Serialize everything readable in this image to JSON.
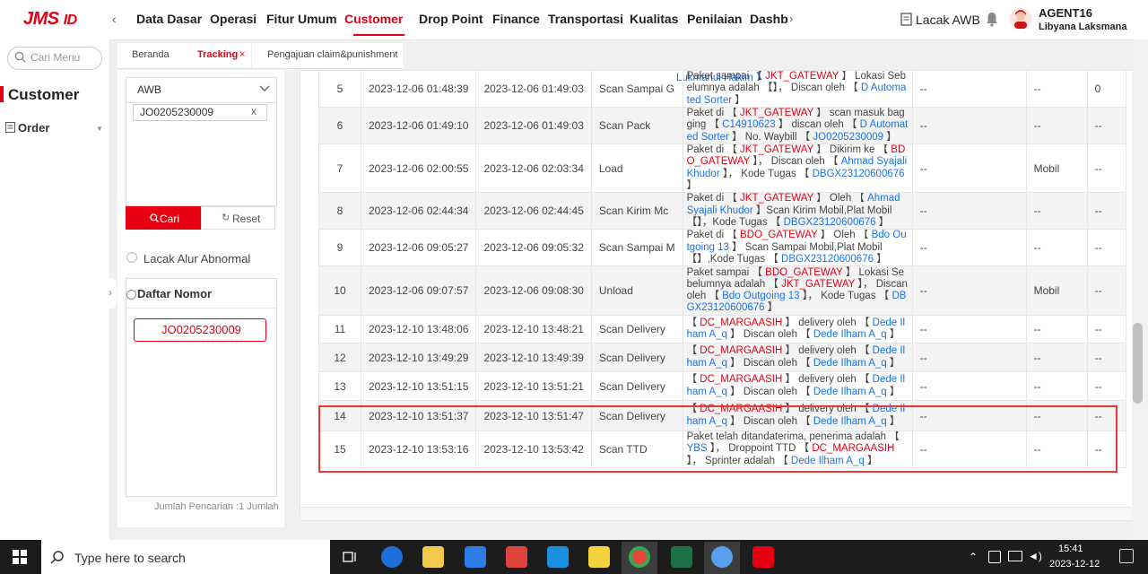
{
  "brand": {
    "logo": "JMS",
    "logo_suffix": "ID"
  },
  "nav": {
    "items": [
      "Data Dasar",
      "Operasi",
      "Fitur Umum",
      "Customer",
      "Drop Point",
      "Finance",
      "Transportasi",
      "Kualitas",
      "Penilaian",
      "Dashb"
    ],
    "active": "Customer",
    "lacak_awb": "Lacak AWB",
    "agent_code": "AGENT16",
    "agent_name": "Libyana Laksmana"
  },
  "sidebar": {
    "search_placeholder": "Cari Menu",
    "section_title": "Customer",
    "order_label": "Order"
  },
  "tabs": [
    {
      "label": "Beranda"
    },
    {
      "label": "Tracking",
      "close": "×"
    },
    {
      "label": "Pengajuan claim&punishment"
    }
  ],
  "filter": {
    "awb_type": "AWB",
    "awb_tag": "JO0205230009",
    "awb_tag_close": "x",
    "search_button": "Cari",
    "reset_button": "Reset",
    "abnormal_label": "Lacak Alur Abnormal",
    "list_title": "Daftar Nomor",
    "list_items": [
      "JO0205230009"
    ],
    "count_text": "Jumlah Pencarian :1  Jumlah"
  },
  "table": {
    "top_partial": "Lukmanul Hakim 】",
    "rows": [
      {
        "no": "5",
        "scan_time": "2023-12-06 01:48:39",
        "upload_time": "2023-12-06 01:49:03",
        "type": "Scan Sampai G",
        "desc": [
          [
            "Paket sampai 【 ",
            ""
          ],
          [
            "JKT_GATEWAY",
            "red"
          ],
          [
            " 】 Lokasi Sebelumnya adalah 【】， Discan oleh 【 ",
            ""
          ],
          [
            "D Automated Sorter",
            "blue"
          ],
          [
            " 】",
            ""
          ]
        ],
        "c6": "--",
        "c7": "--",
        "c8": "0"
      },
      {
        "no": "6",
        "scan_time": "2023-12-06 01:49:10",
        "upload_time": "2023-12-06 01:49:03",
        "type": "Scan Pack",
        "desc": [
          [
            "Paket di 【 ",
            ""
          ],
          [
            "JKT_GATEWAY",
            "red"
          ],
          [
            " 】 scan masuk bagging 【 ",
            ""
          ],
          [
            "C14910623",
            "blue"
          ],
          [
            " 】 discan oleh 【 ",
            ""
          ],
          [
            "D Automated Sorter",
            "blue"
          ],
          [
            " 】 No. Waybill 【 ",
            ""
          ],
          [
            "JO0205230009",
            "blue"
          ],
          [
            " 】",
            ""
          ]
        ],
        "c6": "--",
        "c7": "--",
        "c8": "--"
      },
      {
        "no": "7",
        "scan_time": "2023-12-06 02:00:55",
        "upload_time": "2023-12-06 02:03:34",
        "type": "Load",
        "desc": [
          [
            "Paket di 【 ",
            ""
          ],
          [
            "JKT_GATEWAY",
            "red"
          ],
          [
            " 】 Dikirim ke 【 ",
            ""
          ],
          [
            "BDO_GATEWAY",
            "red"
          ],
          [
            " 】， Discan oleh 【 ",
            ""
          ],
          [
            "Ahmad Syajali Khudor",
            "blue"
          ],
          [
            " 】， Kode Tugas 【 ",
            ""
          ],
          [
            "DBGX23120600676",
            "blue"
          ],
          [
            " 】",
            ""
          ]
        ],
        "c6": "--",
        "c7": "Mobil",
        "c8": "--"
      },
      {
        "no": "8",
        "scan_time": "2023-12-06 02:44:34",
        "upload_time": "2023-12-06 02:44:45",
        "type": "Scan Kirim Mc",
        "desc": [
          [
            "Paket di 【 ",
            ""
          ],
          [
            "JKT_GATEWAY",
            "red"
          ],
          [
            " 】 Oleh 【 ",
            ""
          ],
          [
            "Ahmad Syajali Khudor",
            "blue"
          ],
          [
            " 】Scan Kirim Mobil,Plat Mobil 【】，Kode Tugas 【 ",
            ""
          ],
          [
            "DBGX23120600676",
            "blue"
          ],
          [
            " 】",
            ""
          ]
        ],
        "c6": "--",
        "c7": "--",
        "c8": "--"
      },
      {
        "no": "9",
        "scan_time": "2023-12-06 09:05:27",
        "upload_time": "2023-12-06 09:05:32",
        "type": "Scan Sampai M",
        "desc": [
          [
            "Paket di 【 ",
            ""
          ],
          [
            "BDO_GATEWAY",
            "red"
          ],
          [
            " 】 Oleh 【 ",
            ""
          ],
          [
            "Bdo Outgoing 13",
            "blue"
          ],
          [
            " 】 Scan Sampai Mobil,Plat Mobil 【】,Kode Tugas 【 ",
            ""
          ],
          [
            "DBGX23120600676",
            "blue"
          ],
          [
            " 】",
            ""
          ]
        ],
        "c6": "--",
        "c7": "--",
        "c8": "--"
      },
      {
        "no": "10",
        "scan_time": "2023-12-06 09:07:57",
        "upload_time": "2023-12-06 09:08:30",
        "type": "Unload",
        "desc": [
          [
            "Paket sampai 【 ",
            ""
          ],
          [
            "BDO_GATEWAY",
            "red"
          ],
          [
            " 】 Lokasi Sebelumnya adalah 【 ",
            ""
          ],
          [
            "JKT_GATEWAY",
            "red"
          ],
          [
            " 】， Discan oleh 【 ",
            ""
          ],
          [
            "Bdo Outgoing 13",
            "blue"
          ],
          [
            " 】， Kode Tugas 【 ",
            ""
          ],
          [
            "DBGX23120600676",
            "blue"
          ],
          [
            " 】",
            ""
          ]
        ],
        "c6": "--",
        "c7": "Mobil",
        "c8": "--"
      },
      {
        "no": "11",
        "scan_time": "2023-12-10 13:48:06",
        "upload_time": "2023-12-10 13:48:21",
        "type": "Scan Delivery",
        "desc": [
          [
            "【 ",
            ""
          ],
          [
            "DC_MARGAASIH",
            "red"
          ],
          [
            " 】 delivery oleh 【 ",
            ""
          ],
          [
            "Dede Ilham A_q",
            "blue"
          ],
          [
            " 】 Discan oleh 【 ",
            ""
          ],
          [
            "Dede Ilham A_q",
            "blue"
          ],
          [
            " 】",
            ""
          ]
        ],
        "c6": "--",
        "c7": "--",
        "c8": "--"
      },
      {
        "no": "12",
        "scan_time": "2023-12-10 13:49:29",
        "upload_time": "2023-12-10 13:49:39",
        "type": "Scan Delivery",
        "desc": [
          [
            "【 ",
            ""
          ],
          [
            "DC_MARGAASIH",
            "red"
          ],
          [
            " 】 delivery oleh 【 ",
            ""
          ],
          [
            "Dede Ilham A_q",
            "blue"
          ],
          [
            " 】 Discan oleh 【 ",
            ""
          ],
          [
            "Dede Ilham A_q",
            "blue"
          ],
          [
            " 】",
            ""
          ]
        ],
        "c6": "--",
        "c7": "--",
        "c8": "--"
      },
      {
        "no": "13",
        "scan_time": "2023-12-10 13:51:15",
        "upload_time": "2023-12-10 13:51:21",
        "type": "Scan Delivery",
        "desc": [
          [
            "【 ",
            ""
          ],
          [
            "DC_MARGAASIH",
            "red"
          ],
          [
            " 】 delivery oleh 【 ",
            ""
          ],
          [
            "Dede Ilham A_q",
            "blue"
          ],
          [
            " 】 Discan oleh 【 ",
            ""
          ],
          [
            "Dede Ilham A_q",
            "blue"
          ],
          [
            " 】",
            ""
          ]
        ],
        "c6": "--",
        "c7": "--",
        "c8": "--"
      },
      {
        "no": "14",
        "scan_time": "2023-12-10 13:51:37",
        "upload_time": "2023-12-10 13:51:47",
        "type": "Scan Delivery",
        "desc": [
          [
            "【 ",
            ""
          ],
          [
            "DC_MARGAASIH",
            "red"
          ],
          [
            " 】 delivery oleh 【 ",
            ""
          ],
          [
            "Dede Ilham A_q",
            "blue"
          ],
          [
            " 】 Discan oleh 【 ",
            ""
          ],
          [
            "Dede Ilham A_q",
            "blue"
          ],
          [
            " 】",
            ""
          ]
        ],
        "c6": "--",
        "c7": "--",
        "c8": "--"
      },
      {
        "no": "15",
        "scan_time": "2023-12-10 13:53:16",
        "upload_time": "2023-12-10 13:53:42",
        "type": "Scan TTD",
        "type_color": "green",
        "desc": [
          [
            "Paket telah ditandaterima, penerima adalah 【 ",
            ""
          ],
          [
            "YBS",
            "blue"
          ],
          [
            " 】， Droppoint TTD 【 ",
            ""
          ],
          [
            "DC_MARGAASIH",
            "red"
          ],
          [
            " 】， Sprinter adalah 【 ",
            ""
          ],
          [
            "Dede Ilham A_q",
            "blue"
          ],
          [
            " 】",
            ""
          ]
        ],
        "c6": "--",
        "c7": "--",
        "c8": "--"
      }
    ]
  },
  "taskbar": {
    "search_placeholder": "Type here to search",
    "time": "15:41",
    "date": "2023-12-12"
  },
  "colors": {
    "brand_red": "#e60012",
    "link_blue": "#1a73e8",
    "ttd_green": "#2aa940",
    "highlight": "#e53935"
  }
}
